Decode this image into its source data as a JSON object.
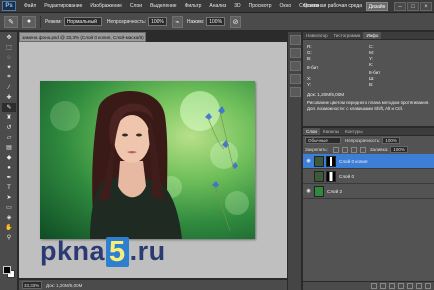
{
  "menubar": {
    "logo": "Ps",
    "items": [
      "Файл",
      "Редактирование",
      "Изображение",
      "Слои",
      "Выделение",
      "Фильтр",
      "Анализ",
      "3D",
      "Просмотр",
      "Окно",
      "Справка"
    ],
    "zoom": "33,3%",
    "workspace": "Основная рабочая среда",
    "design_button": "Дизайн",
    "win_controls": [
      "–",
      "□",
      "×"
    ]
  },
  "optbar": {
    "mode_label": "Режим:",
    "mode_value": "Нормальный",
    "opacity_label": "Непрозрачность:",
    "opacity_value": "100%",
    "pressure_label": "Нажим:",
    "pressure_value": "100%"
  },
  "document": {
    "tab_title": "заменa фона.psd @ 33,3% (Слой 0 копия, Слой-маска/8) *",
    "zoom": "33,33%",
    "doc_size": "Док: 1,20M/5,00M"
  },
  "watermark": {
    "pre": "pkna",
    "five": "5",
    "post": ".ru"
  },
  "info_panel": {
    "tabs": [
      "Навигатор",
      "Гистограмма",
      "Инфо"
    ],
    "r": "R:",
    "g": "G:",
    "b": "B:",
    "c": "C:",
    "m": "M:",
    "y": "Y:",
    "k": "K:",
    "bit": "8-бит",
    "x": "X:",
    "y_coord": "Y:",
    "w": "Ш:",
    "h": "В:",
    "doc": "Док: 1,20M/5,00M",
    "hint": "Рисование цветом переднего плана методом протягивания. Доп. возможности: с клавишами Shift, Alt и Ctrl."
  },
  "layers_panel": {
    "tabs": [
      "Слои",
      "Каналы",
      "Контуры"
    ],
    "blend_mode": "Обычные",
    "opacity_label": "Непрозрачность:",
    "opacity_value": "100%",
    "lock_label": "Закрепить:",
    "fill_label": "Заливка:",
    "fill_value": "100%",
    "layers": [
      {
        "name": "Слой 0 копия",
        "selected": true
      },
      {
        "name": "Слой 0",
        "selected": false
      },
      {
        "name": "Слой 2",
        "selected": false
      }
    ]
  },
  "colors": {
    "selection": "#3d7fd6",
    "canvas_bg": "#bfbfbf",
    "watermark_text": "#2a3a72",
    "watermark_five_bg": "#2f7fd0"
  }
}
